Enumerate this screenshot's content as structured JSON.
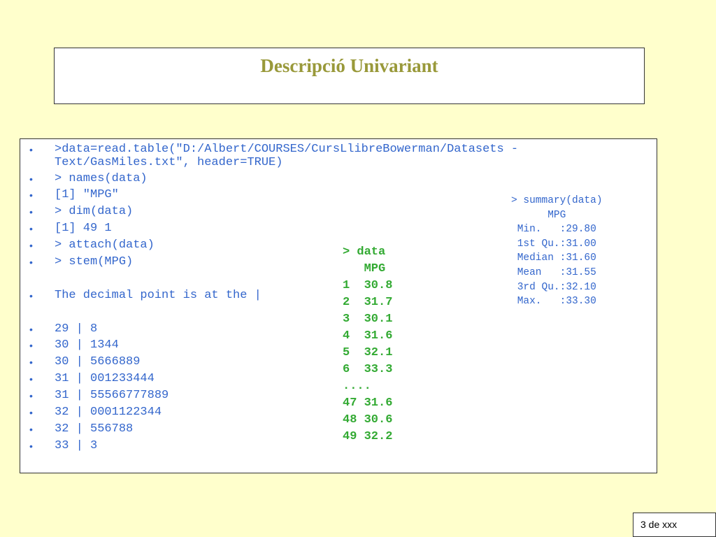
{
  "title": "Descripció Univariant",
  "commands": [
    ">data=read.table(\"D:/Albert/COURSES/CursLlibreBowerman/Datasets -",
    "Text/GasMiles.txt\", header=TRUE)",
    "> names(data)",
    "[1] \"MPG\"",
    "> dim(data)",
    "[1] 49  1",
    "> attach(data)",
    "> stem(MPG)",
    "  The decimal point is at the |",
    "  29 | 8",
    "  30 | 1344",
    "  30 | 5666889",
    "  31 | 001233444",
    "  31 | 55566777889",
    "  32 | 0001122344",
    "  32 | 556788",
    "  33 | 3"
  ],
  "bullet": "•",
  "data_listing": {
    "header": "> data",
    "column": "   MPG",
    "rows": [
      "1  30.8",
      "2  31.7",
      "3  30.1",
      "4  31.6",
      "5  32.1",
      "6  33.3",
      "....",
      "47 31.6",
      "48 30.6",
      "49 32.2"
    ]
  },
  "summary": {
    "command": "> summary(data)",
    "column": "      MPG",
    "rows": [
      " Min.   :29.80",
      " 1st Qu.:31.00",
      " Median :31.60",
      " Mean   :31.55",
      " 3rd Qu.:32.10",
      " Max.   :33.30"
    ]
  },
  "page_number": "3 de xxx",
  "colors": {
    "background": "#ffffcc",
    "title": "#99993a",
    "code_blue": "#3366cc",
    "code_green": "#33aa33"
  }
}
